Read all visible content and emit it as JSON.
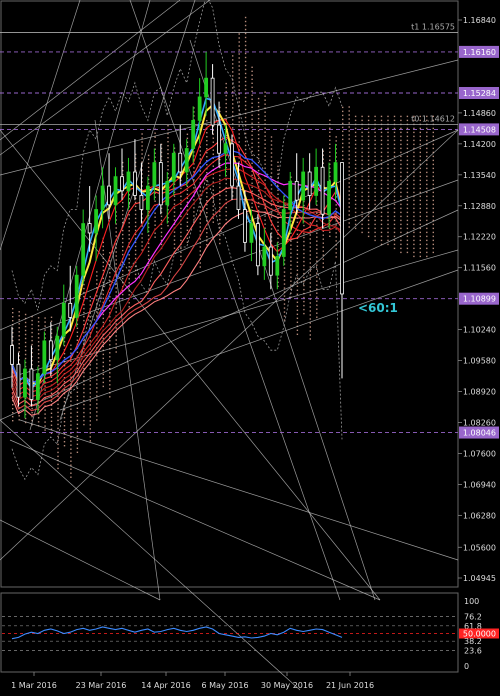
{
  "chart_data": [
    {
      "type": "candlestick",
      "y_ticks": [
        "1.16840",
        "1.16160",
        "1.15284",
        "1.14860",
        "1.14508",
        "1.14200",
        "1.13540",
        "1.12880",
        "1.12220",
        "1.11560",
        "1.10899",
        "1.10240",
        "1.09580",
        "1.08920",
        "1.08260",
        "1.08046",
        "1.07600",
        "1.06940",
        "1.06280",
        "1.05600",
        "1.04945"
      ],
      "ylim": [
        1.04945,
        1.1684
      ],
      "x_ticks": [
        "1 Mar 2016",
        "23 Mar 2016",
        "14 Apr 2016",
        "6 May 2016",
        "30 May 2016",
        "21 Jun 2016"
      ],
      "highlighted_levels": [
        {
          "label": "1.16160",
          "value": 1.1616,
          "color": "#9966cc"
        },
        {
          "label": "1.15284",
          "value": 1.15284,
          "color": "#9966cc"
        },
        {
          "label": "1.14508",
          "value": 1.14508,
          "color": "#9966cc"
        },
        {
          "label": "1.10899",
          "value": 1.10899,
          "color": "#9966cc"
        },
        {
          "label": "1.08046",
          "value": 1.08046,
          "color": "#9966cc"
        }
      ],
      "line_labels": [
        {
          "text": "t1 1.16575",
          "value": 1.16575
        },
        {
          "text": "t0 1.14612",
          "value": 1.14612
        }
      ],
      "annotations": [
        {
          "text": "<60:1",
          "color": "#33c7d6"
        }
      ],
      "colors": {
        "bull": "#22cc22",
        "bear": "#ffffff",
        "background": "#000000",
        "grid": "#ffffff"
      },
      "candles": [
        {
          "o": 1.099,
          "h": 1.103,
          "l": 1.09,
          "c": 1.095
        },
        {
          "o": 1.095,
          "h": 1.0975,
          "l": 1.086,
          "c": 1.088
        },
        {
          "o": 1.088,
          "h": 1.096,
          "l": 1.0835,
          "c": 1.094
        },
        {
          "o": 1.094,
          "h": 1.099,
          "l": 1.086,
          "c": 1.0875
        },
        {
          "o": 1.0875,
          "h": 1.0945,
          "l": 1.0845,
          "c": 1.093
        },
        {
          "o": 1.093,
          "h": 1.102,
          "l": 1.091,
          "c": 1.1
        },
        {
          "o": 1.1,
          "h": 1.104,
          "l": 1.0925,
          "c": 1.096
        },
        {
          "o": 1.096,
          "h": 1.103,
          "l": 1.091,
          "c": 1.101
        },
        {
          "o": 1.101,
          "h": 1.112,
          "l": 1.099,
          "c": 1.108
        },
        {
          "o": 1.108,
          "h": 1.116,
          "l": 1.102,
          "c": 1.105
        },
        {
          "o": 1.105,
          "h": 1.116,
          "l": 1.103,
          "c": 1.114
        },
        {
          "o": 1.114,
          "h": 1.128,
          "l": 1.112,
          "c": 1.125
        },
        {
          "o": 1.125,
          "h": 1.133,
          "l": 1.119,
          "c": 1.123
        },
        {
          "o": 1.123,
          "h": 1.131,
          "l": 1.117,
          "c": 1.128
        },
        {
          "o": 1.128,
          "h": 1.137,
          "l": 1.124,
          "c": 1.133
        },
        {
          "o": 1.133,
          "h": 1.14,
          "l": 1.126,
          "c": 1.129
        },
        {
          "o": 1.129,
          "h": 1.137,
          "l": 1.125,
          "c": 1.135
        },
        {
          "o": 1.135,
          "h": 1.141,
          "l": 1.13,
          "c": 1.132
        },
        {
          "o": 1.132,
          "h": 1.139,
          "l": 1.128,
          "c": 1.136
        },
        {
          "o": 1.136,
          "h": 1.143,
          "l": 1.13,
          "c": 1.131
        },
        {
          "o": 1.131,
          "h": 1.138,
          "l": 1.125,
          "c": 1.128
        },
        {
          "o": 1.128,
          "h": 1.135,
          "l": 1.123,
          "c": 1.133
        },
        {
          "o": 1.133,
          "h": 1.141,
          "l": 1.13,
          "c": 1.138
        },
        {
          "o": 1.138,
          "h": 1.142,
          "l": 1.127,
          "c": 1.129
        },
        {
          "o": 1.129,
          "h": 1.136,
          "l": 1.125,
          "c": 1.134
        },
        {
          "o": 1.134,
          "h": 1.142,
          "l": 1.131,
          "c": 1.14
        },
        {
          "o": 1.14,
          "h": 1.146,
          "l": 1.133,
          "c": 1.136
        },
        {
          "o": 1.136,
          "h": 1.143,
          "l": 1.133,
          "c": 1.141
        },
        {
          "o": 1.141,
          "h": 1.15,
          "l": 1.138,
          "c": 1.147
        },
        {
          "o": 1.147,
          "h": 1.156,
          "l": 1.142,
          "c": 1.152
        },
        {
          "o": 1.152,
          "h": 1.1616,
          "l": 1.148,
          "c": 1.156
        },
        {
          "o": 1.156,
          "h": 1.159,
          "l": 1.144,
          "c": 1.146
        },
        {
          "o": 1.146,
          "h": 1.151,
          "l": 1.137,
          "c": 1.14
        },
        {
          "o": 1.14,
          "h": 1.146,
          "l": 1.135,
          "c": 1.142
        },
        {
          "o": 1.142,
          "h": 1.144,
          "l": 1.13,
          "c": 1.133
        },
        {
          "o": 1.133,
          "h": 1.138,
          "l": 1.126,
          "c": 1.128
        },
        {
          "o": 1.128,
          "h": 1.132,
          "l": 1.119,
          "c": 1.121
        },
        {
          "o": 1.121,
          "h": 1.128,
          "l": 1.117,
          "c": 1.125
        },
        {
          "o": 1.125,
          "h": 1.127,
          "l": 1.114,
          "c": 1.116
        },
        {
          "o": 1.116,
          "h": 1.124,
          "l": 1.113,
          "c": 1.12
        },
        {
          "o": 1.12,
          "h": 1.123,
          "l": 1.111,
          "c": 1.114
        },
        {
          "o": 1.114,
          "h": 1.121,
          "l": 1.111,
          "c": 1.118
        },
        {
          "o": 1.118,
          "h": 1.131,
          "l": 1.116,
          "c": 1.128
        },
        {
          "o": 1.128,
          "h": 1.136,
          "l": 1.123,
          "c": 1.134
        },
        {
          "o": 1.134,
          "h": 1.14,
          "l": 1.127,
          "c": 1.13
        },
        {
          "o": 1.13,
          "h": 1.139,
          "l": 1.125,
          "c": 1.136
        },
        {
          "o": 1.136,
          "h": 1.14,
          "l": 1.128,
          "c": 1.131
        },
        {
          "o": 1.131,
          "h": 1.141,
          "l": 1.129,
          "c": 1.137
        },
        {
          "o": 1.137,
          "h": 1.141,
          "l": 1.124,
          "c": 1.127
        },
        {
          "o": 1.127,
          "h": 1.138,
          "l": 1.124,
          "c": 1.134
        },
        {
          "o": 1.134,
          "h": 1.142,
          "l": 1.13,
          "c": 1.138
        },
        {
          "o": 1.138,
          "h": 1.138,
          "l": 1.092,
          "c": 1.11
        }
      ],
      "indicator": {
        "levels": [
          "100",
          "76.2",
          "61.8",
          "50.0000",
          "38.2",
          "23.6",
          "0"
        ],
        "ylim": [
          0,
          100
        ],
        "highlight_level": {
          "label": "50.0000",
          "color": "#ff2222"
        },
        "values": [
          42,
          44,
          49,
          52,
          50,
          55,
          57,
          54,
          50,
          52,
          56,
          58,
          55,
          57,
          60,
          58,
          56,
          58,
          55,
          52,
          55,
          57,
          52,
          53,
          56,
          58,
          55,
          53,
          55,
          58,
          60,
          57,
          50,
          48,
          46,
          44,
          45,
          43,
          44,
          46,
          50,
          48,
          52,
          58,
          55,
          53,
          55,
          57,
          56,
          52,
          48,
          44
        ]
      }
    }
  ]
}
